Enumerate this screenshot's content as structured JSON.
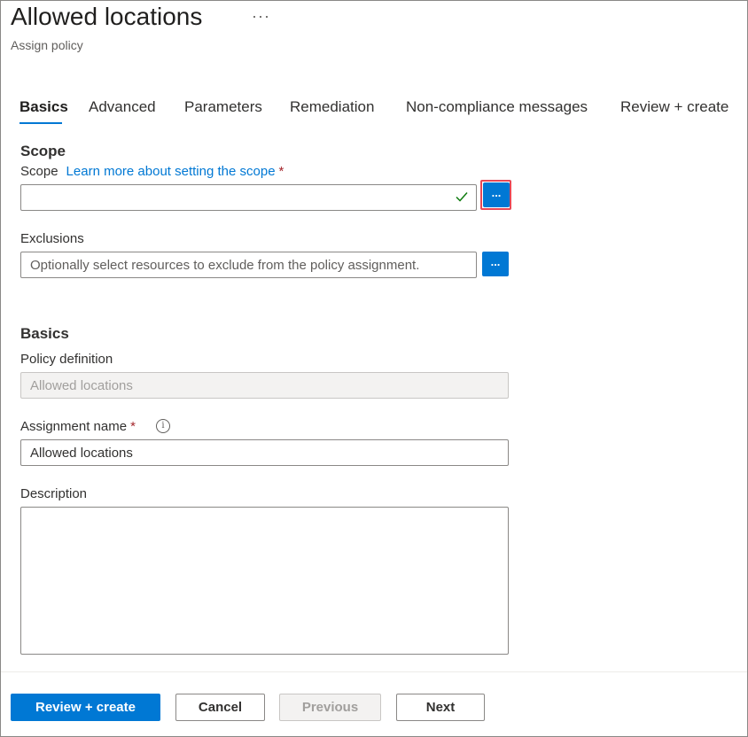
{
  "header": {
    "title": "Allowed locations",
    "more_glyph": "···",
    "subtitle": "Assign policy"
  },
  "tabs": [
    {
      "label": "Basics",
      "active": true
    },
    {
      "label": "Advanced",
      "active": false
    },
    {
      "label": "Parameters",
      "active": false
    },
    {
      "label": "Remediation",
      "active": false
    },
    {
      "label": "Non-compliance messages",
      "active": false
    },
    {
      "label": "Review + create",
      "active": false
    }
  ],
  "scope_section": {
    "heading": "Scope",
    "scope_label": "Scope",
    "scope_link": "Learn more about setting the scope",
    "required_mark": "*",
    "scope_value": "",
    "browse_button": "...",
    "exclusions_label": "Exclusions",
    "exclusions_placeholder": "Optionally select resources to exclude from the policy assignment.",
    "exclusions_button": "..."
  },
  "basics_section": {
    "heading": "Basics",
    "policy_definition_label": "Policy definition",
    "policy_definition_value": "Allowed locations",
    "assignment_name_label": "Assignment name",
    "required_mark": "*",
    "info_glyph": "i",
    "assignment_name_value": "Allowed locations",
    "description_label": "Description",
    "description_value": ""
  },
  "footer": {
    "review_create": "Review + create",
    "cancel": "Cancel",
    "previous": "Previous",
    "next": "Next"
  },
  "colors": {
    "accent": "#0078d4",
    "required": "#a4262c",
    "highlight": "#e74856",
    "check": "#107c10"
  },
  "icons": {
    "more": "more-icon",
    "check": "checkmark-icon",
    "info": "info-icon"
  }
}
